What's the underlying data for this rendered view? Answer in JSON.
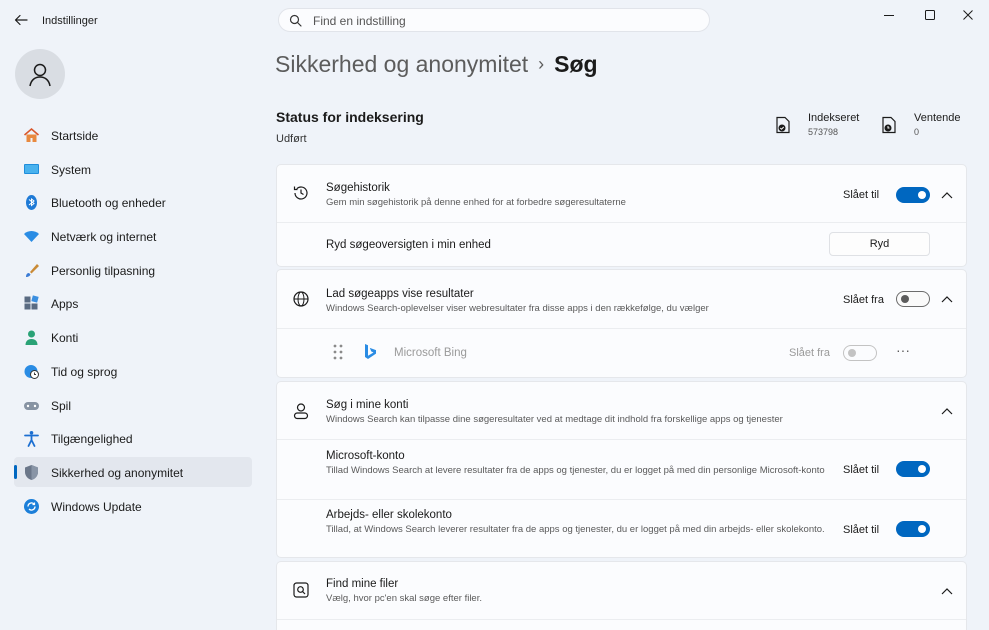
{
  "window": {
    "app_title": "Indstillinger",
    "search_placeholder": "Find en indstilling"
  },
  "sidebar": {
    "items": [
      {
        "label": "Startside",
        "icon": "home-icon"
      },
      {
        "label": "System",
        "icon": "monitor-icon"
      },
      {
        "label": "Bluetooth og enheder",
        "icon": "bluetooth-icon"
      },
      {
        "label": "Netværk og internet",
        "icon": "wifi-icon"
      },
      {
        "label": "Personlig tilpasning",
        "icon": "brush-icon"
      },
      {
        "label": "Apps",
        "icon": "apps-icon"
      },
      {
        "label": "Konti",
        "icon": "person-icon"
      },
      {
        "label": "Tid og sprog",
        "icon": "globe-clock-icon"
      },
      {
        "label": "Spil",
        "icon": "gamepad-icon"
      },
      {
        "label": "Tilgængelighed",
        "icon": "accessibility-icon"
      },
      {
        "label": "Sikkerhed og anonymitet",
        "icon": "shield-icon",
        "active": true
      },
      {
        "label": "Windows Update",
        "icon": "update-icon"
      }
    ]
  },
  "breadcrumb": {
    "parent": "Sikkerhed og anonymitet",
    "separator": "›",
    "current": "Søg"
  },
  "status": {
    "title": "Status for indeksering",
    "value": "Udført",
    "indexed_label": "Indekseret",
    "indexed_count": "573798",
    "pending_label": "Ventende",
    "pending_count": "0"
  },
  "history": {
    "title": "Søgehistorik",
    "desc": "Gem min søgehistorik på denne enhed for at forbedre søgeresultaterne",
    "state": "Slået til",
    "clear_label": "Ryd søgeoversigten i min enhed",
    "clear_button": "Ryd"
  },
  "searchapps": {
    "title": "Lad søgeapps vise resultater",
    "desc": "Windows Search-oplevelser viser webresultater fra disse apps i den rækkefølge, du vælger",
    "state": "Slået fra",
    "bing_label": "Microsoft Bing",
    "bing_state": "Slået fra",
    "more": "···"
  },
  "accounts": {
    "title": "Søg i mine konti",
    "desc": "Windows Search kan tilpasse dine søgeresultater ved at medtage dit indhold fra forskellige apps og tjenester",
    "ms_title": "Microsoft-konto",
    "ms_desc": "Tillad Windows Search at levere resultater fra de apps og tjenester, du er logget på med din personlige Microsoft-konto",
    "ms_state": "Slået til",
    "work_title": "Arbejds- eller skolekonto",
    "work_desc": "Tillad, at Windows Search leverer resultater fra de apps og tjenester, du er logget på med din arbejds- eller skolekonto.",
    "work_state": "Slået til"
  },
  "files": {
    "title": "Find mine filer",
    "desc": "Vælg, hvor pc'en skal søge efter filer."
  },
  "colors": {
    "accent": "#0067c0",
    "background": "#eff3f9",
    "card": "#fbfcfe"
  }
}
